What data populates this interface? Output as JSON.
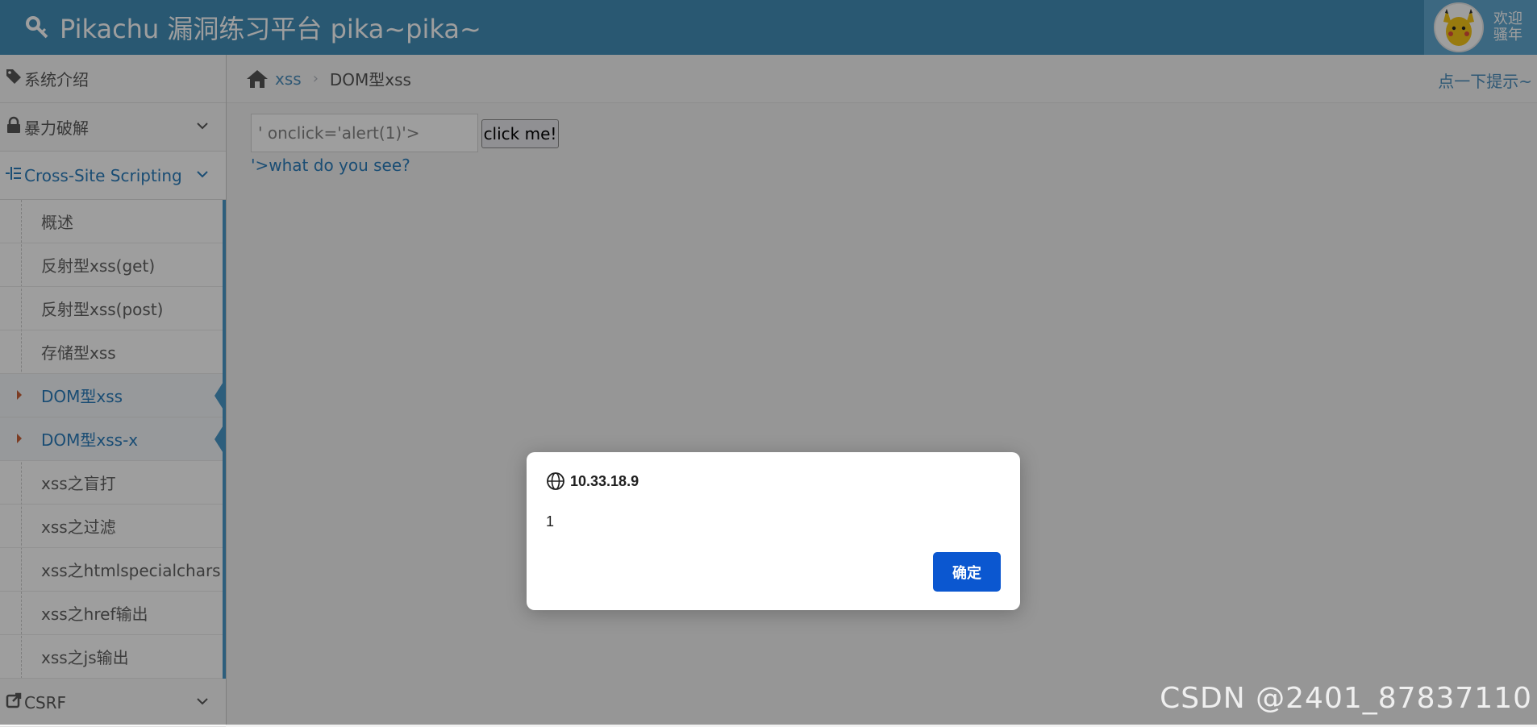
{
  "header": {
    "brand": "Pikachu 漏洞练习平台 pika~pika~",
    "welcome_line1": "欢迎",
    "welcome_line2": "骚年"
  },
  "sidebar": {
    "items": [
      {
        "label": "系统介绍",
        "icon": "tags-icon"
      },
      {
        "label": "暴力破解",
        "icon": "lock-icon"
      },
      {
        "label": "Cross-Site Scripting",
        "icon": "list-icon"
      },
      {
        "label": "CSRF",
        "icon": "share-icon"
      }
    ],
    "xss_sub": [
      "概述",
      "反射型xss(get)",
      "反射型xss(post)",
      "存储型xss",
      "DOM型xss",
      "DOM型xss-x",
      "xss之盲打",
      "xss之过滤",
      "xss之htmlspecialchars",
      "xss之href输出",
      "xss之js输出"
    ]
  },
  "breadcrumb": {
    "link": "xss",
    "current": "DOM型xss",
    "hint": "点一下提示~"
  },
  "main": {
    "input_value": "' onclick='alert(1)'>",
    "button_label": "click me!",
    "result_link": "'>what do you see?"
  },
  "dialog": {
    "title": "10.33.18.9",
    "message": "1",
    "ok_label": "确定"
  },
  "watermark": "CSDN @2401_87837110",
  "colors": {
    "header": "#438eb9",
    "accent": "#2b7dbc",
    "dialog_button": "#0b57d0"
  }
}
